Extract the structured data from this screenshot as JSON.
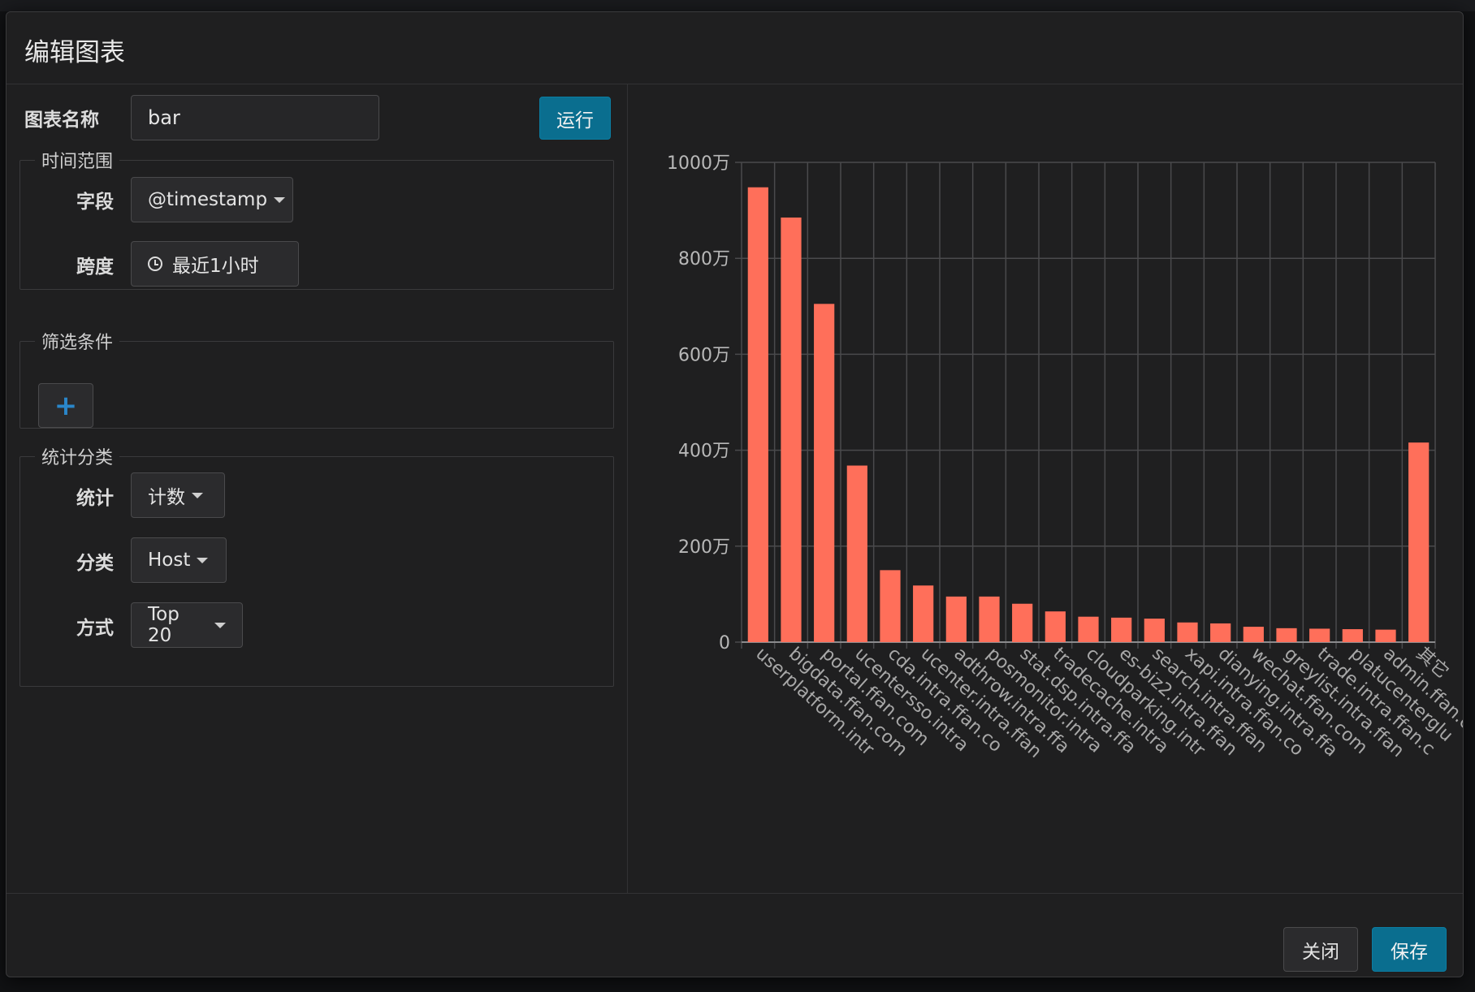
{
  "modal": {
    "title": "编辑图表"
  },
  "form": {
    "chart_name_label": "图表名称",
    "chart_name_value": "bar",
    "run_label": "运行",
    "time_range": {
      "legend": "时间范围",
      "field_label": "字段",
      "field_value": "@timestamp",
      "span_label": "跨度",
      "span_value": "最近1小时"
    },
    "filter": {
      "legend": "筛选条件",
      "add_icon": "plus-icon"
    },
    "stats": {
      "legend": "统计分类",
      "stat_label": "统计",
      "stat_value": "计数",
      "category_label": "分类",
      "category_value": "Host",
      "mode_label": "方式",
      "mode_value": "Top 20"
    }
  },
  "footer": {
    "close_label": "关闭",
    "save_label": "保存"
  },
  "chart_data": {
    "type": "bar",
    "color": "#ff6f5a",
    "ylim": [
      0,
      10000000
    ],
    "yticks": [
      {
        "value": 0,
        "label": "0"
      },
      {
        "value": 2000000,
        "label": "200万"
      },
      {
        "value": 4000000,
        "label": "400万"
      },
      {
        "value": 6000000,
        "label": "600万"
      },
      {
        "value": 8000000,
        "label": "800万"
      },
      {
        "value": 10000000,
        "label": "1000万"
      }
    ],
    "grid": true,
    "categories": [
      "userplatform.intr",
      "bigdata.ffan.com",
      "portal.ffan.com",
      "ucentersso.intra",
      "cda.intra.ffan.co",
      "ucenter.intra.ffan",
      "adthrow.intra.ffa",
      "posmonitor.intra",
      "stat.dsp.intra.ffa",
      "tradecache.intra",
      "cloudparking.intr",
      "es-biz2.intra.ffan",
      "search.intra.ffan",
      "xapi.intra.ffan.co",
      "dianying.intra.ffa",
      "wechat.ffan.com",
      "greylist.intra.ffan",
      "trade.intra.ffan.c",
      "platucenterglu",
      "admin.ffan.c",
      "其它"
    ],
    "values": [
      9480000,
      8850000,
      7050000,
      3680000,
      1500000,
      1180000,
      950000,
      950000,
      800000,
      640000,
      530000,
      510000,
      490000,
      410000,
      390000,
      320000,
      290000,
      280000,
      270000,
      260000,
      4160000
    ]
  }
}
